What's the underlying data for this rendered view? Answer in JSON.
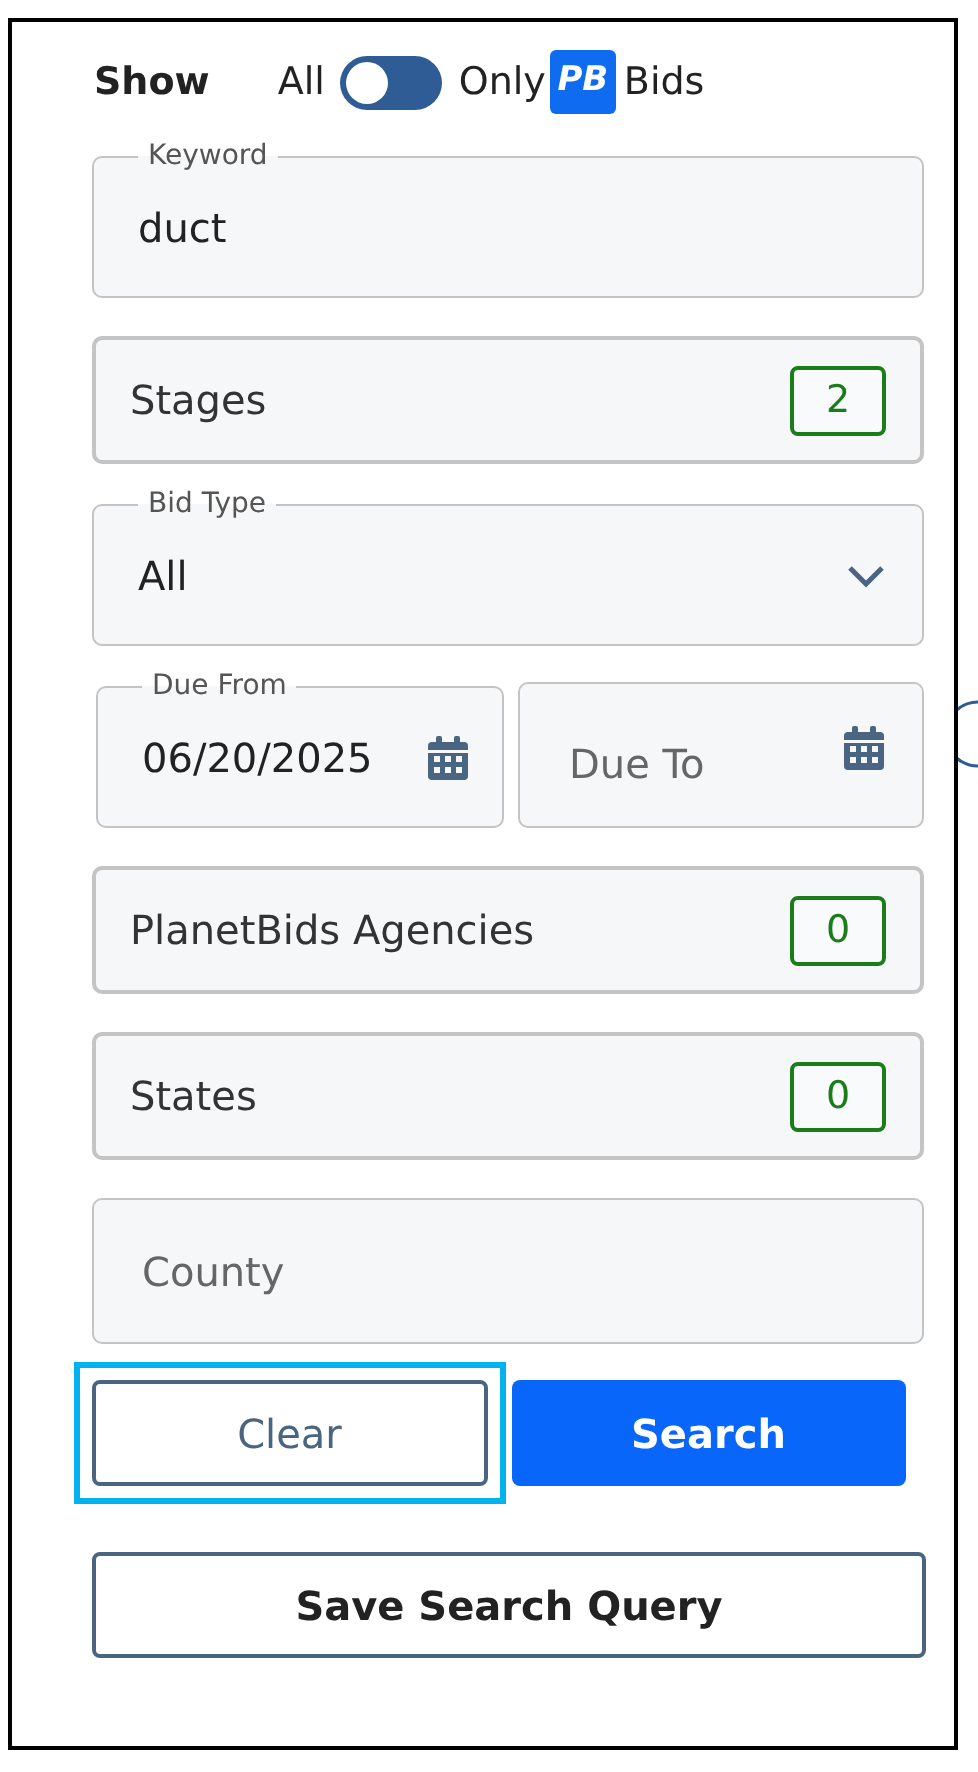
{
  "show_filter": {
    "label": "Show",
    "option_all": "All",
    "toggle_on": false,
    "option_only": "Only",
    "badge": "PB",
    "option_bids": "Bids"
  },
  "fields": [
    {
      "kind": "text",
      "label": "Keyword",
      "value": "duct"
    },
    {
      "kind": "count",
      "label": "Stages",
      "count": "2"
    },
    {
      "kind": "select",
      "label": "Bid Type",
      "value": "All"
    },
    {
      "kind": "dates",
      "from": {
        "label": "Due From",
        "value": "06/20/2025"
      },
      "to": {
        "placeholder": "Due To"
      }
    },
    {
      "kind": "count",
      "label": "PlanetBids Agencies",
      "count": "0"
    },
    {
      "kind": "count",
      "label": "States",
      "count": "0"
    },
    {
      "kind": "placeholder",
      "placeholder": "County"
    }
  ],
  "buttons": [
    {
      "label": "Clear",
      "kind": "outline",
      "focused": true
    },
    {
      "label": "Search",
      "kind": "primary",
      "focused": false
    }
  ],
  "save_button": {
    "label": "Save Search Query"
  }
}
